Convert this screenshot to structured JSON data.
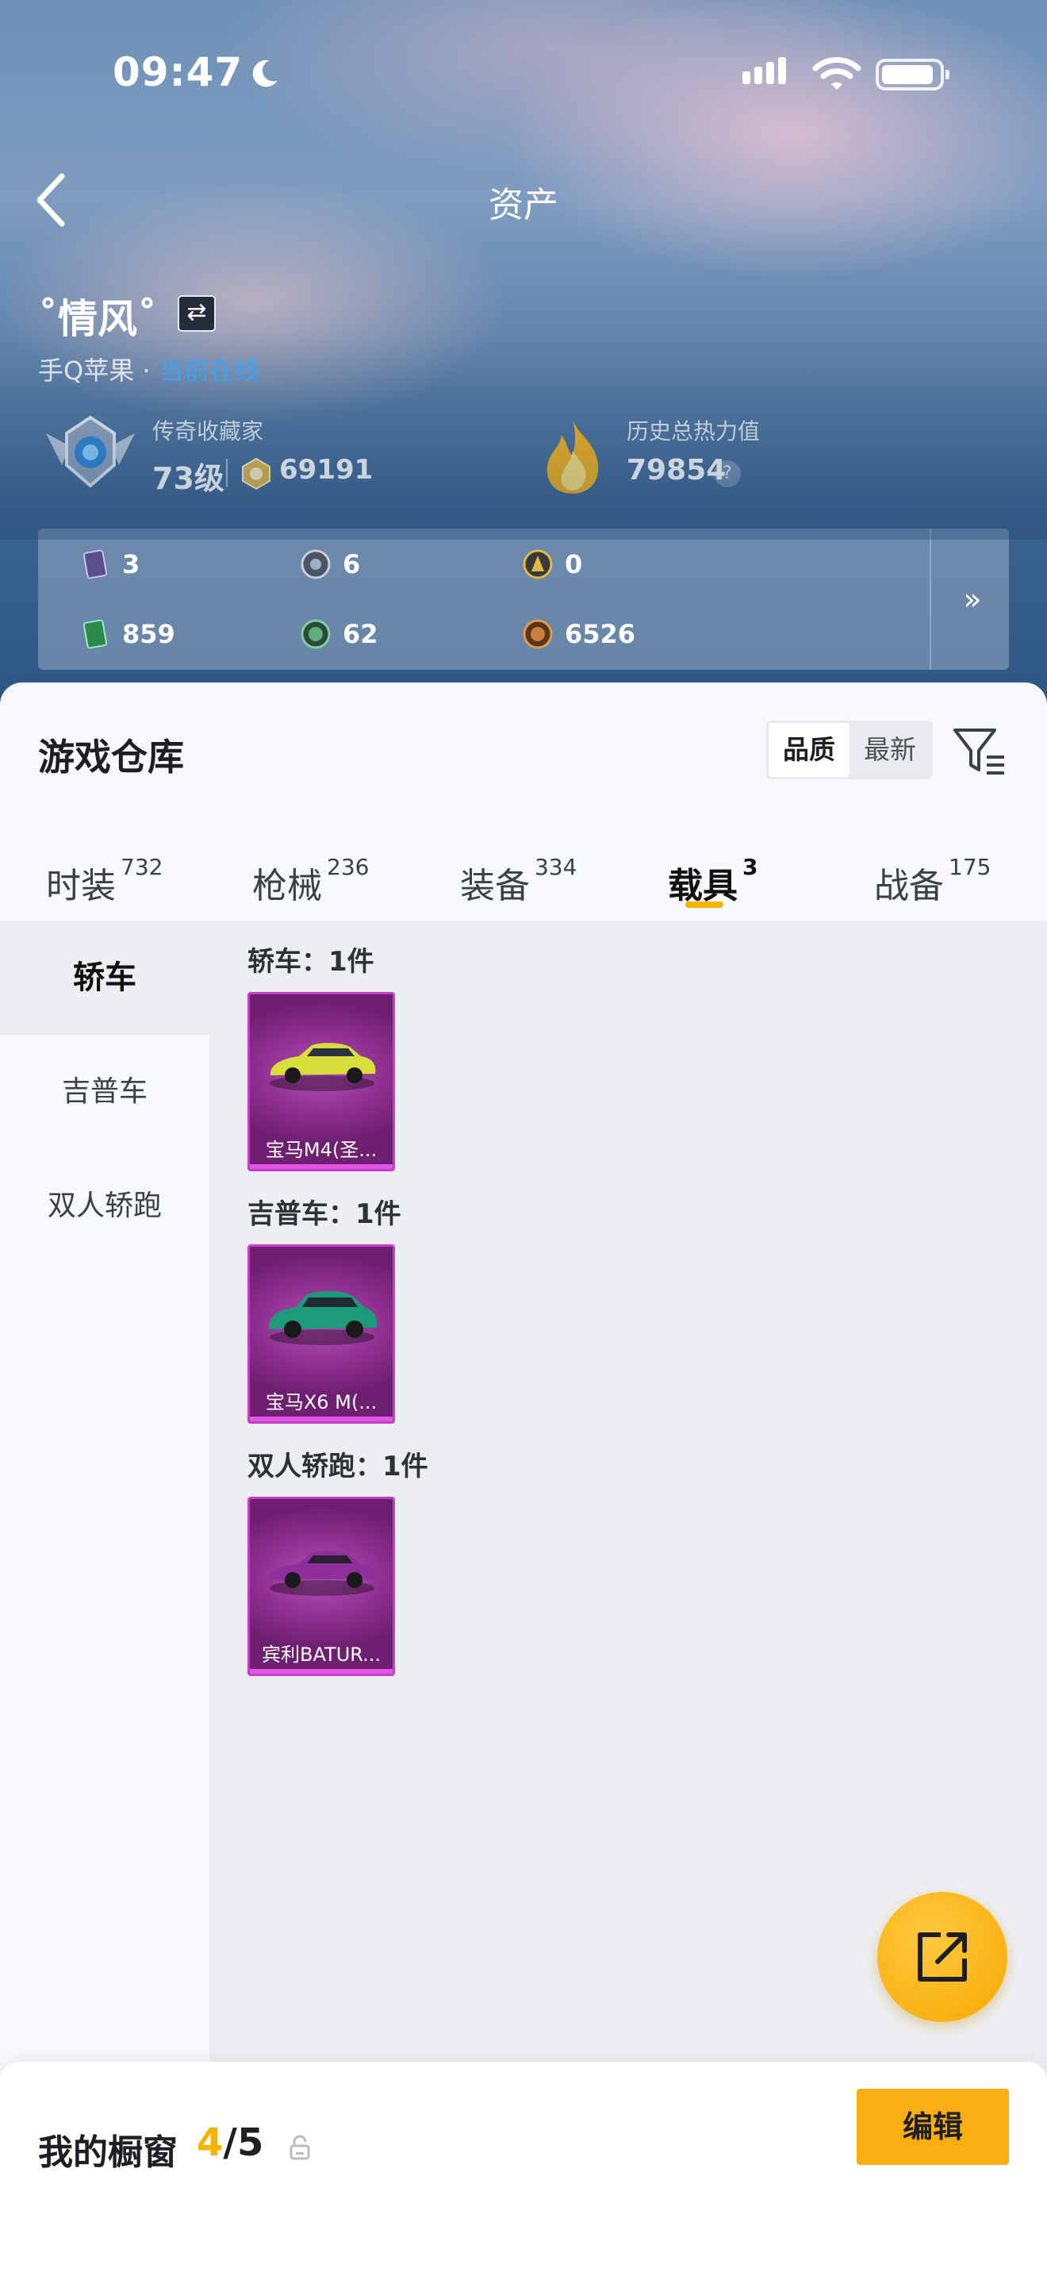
{
  "status_bar": {
    "time": "09:47"
  },
  "header": {
    "title": "资产",
    "back_icon": "chevron-left-icon"
  },
  "player": {
    "name": "˚情风˚",
    "platform": "手Q苹果",
    "platform_separator": "·",
    "online_status": "当前在线"
  },
  "stats": {
    "collector_title": "传奇收藏家",
    "level": "73级",
    "collection_points": "69191",
    "heat_label": "历史总热力值",
    "heat_value": "79854",
    "help_symbol": "?"
  },
  "resources": {
    "items": [
      {
        "value": "3",
        "icon": "card-icon",
        "color": "#5a4f8e"
      },
      {
        "value": "6",
        "icon": "silver-token-icon",
        "color": "#4a5463"
      },
      {
        "value": "0",
        "icon": "gold-token-icon",
        "color": "#c79a2a"
      },
      {
        "value": "859",
        "icon": "green-card-icon",
        "color": "#2c8a4c"
      },
      {
        "value": "62",
        "icon": "jade-coin-icon",
        "color": "#3f7a5a"
      },
      {
        "value": "6526",
        "icon": "bronze-coin-icon",
        "color": "#a66b2a"
      }
    ],
    "more_symbol": "»"
  },
  "warehouse": {
    "title": "游戏仓库",
    "sort_options": [
      "品质",
      "最新"
    ],
    "active_sort": "品质",
    "filter_icon": "filter-icon"
  },
  "tabs": [
    {
      "label": "时装",
      "count": "732"
    },
    {
      "label": "枪械",
      "count": "236"
    },
    {
      "label": "装备",
      "count": "334"
    },
    {
      "label": "载具",
      "count": "3",
      "active": true
    },
    {
      "label": "战备",
      "count": "175"
    }
  ],
  "categories": [
    {
      "label": "轿车",
      "active": true
    },
    {
      "label": "吉普车"
    },
    {
      "label": "双人轿跑"
    }
  ],
  "groups": [
    {
      "title": "轿车：1件",
      "item_name": "宝马M4(圣...",
      "car_color": "#d9df3a"
    },
    {
      "title": "吉普车：1件",
      "item_name": "宝马X6 M(...",
      "car_color": "#1c9a7a"
    },
    {
      "title": "双人轿跑：1件",
      "item_name": "宾利BATUR...",
      "car_color": "#8e2f9c"
    }
  ],
  "showcase": {
    "label": "我的橱窗",
    "current": "4",
    "separator": "/",
    "total": "5",
    "edit_label": "编辑"
  },
  "colors": {
    "accent": "#f5b400",
    "rarity_purple": "#c43fc6",
    "online_blue": "#3ca9ff"
  }
}
